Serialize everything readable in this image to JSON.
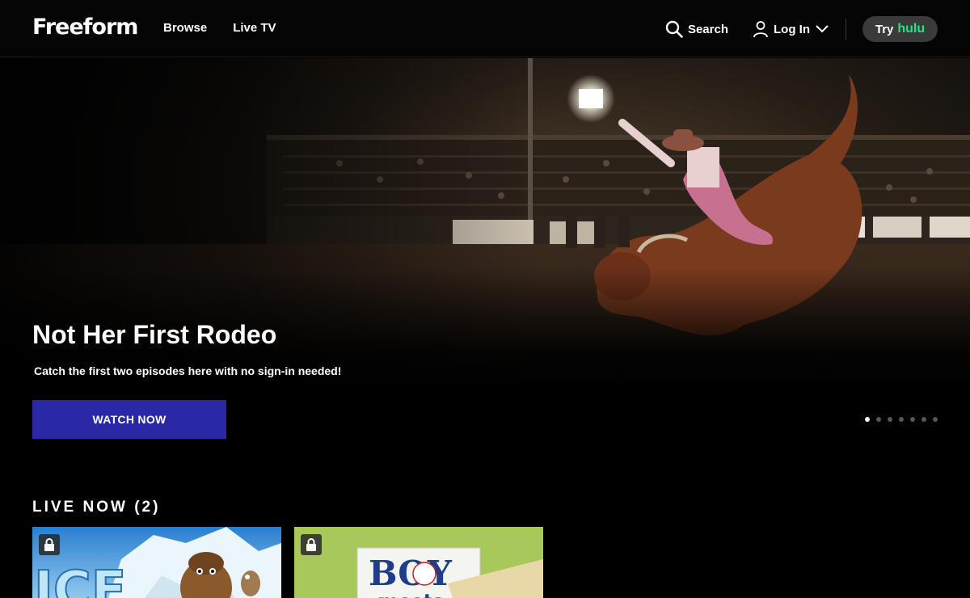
{
  "header": {
    "logo": "Freeform",
    "nav": [
      {
        "label": "Browse"
      },
      {
        "label": "Live TV"
      }
    ],
    "search_label": "Search",
    "login_label": "Log In",
    "try_label": "Try",
    "hulu_label": "hulu"
  },
  "hero": {
    "title": "Not Her First Rodeo",
    "subtitle": "Catch the first two episodes here with no sign-in needed!",
    "cta_label": "WATCH NOW",
    "slide_count": 7,
    "active_slide": 1
  },
  "live_now": {
    "title": "LIVE NOW (2)",
    "tiles": [
      {
        "name": "Ice Age",
        "title_fragment": "ICE"
      },
      {
        "name": "Boy Meets World",
        "title_line1": "BOY",
        "title_line2": "meets"
      }
    ]
  },
  "colors": {
    "accent": "#2a28a6",
    "hulu": "#1ce783"
  }
}
